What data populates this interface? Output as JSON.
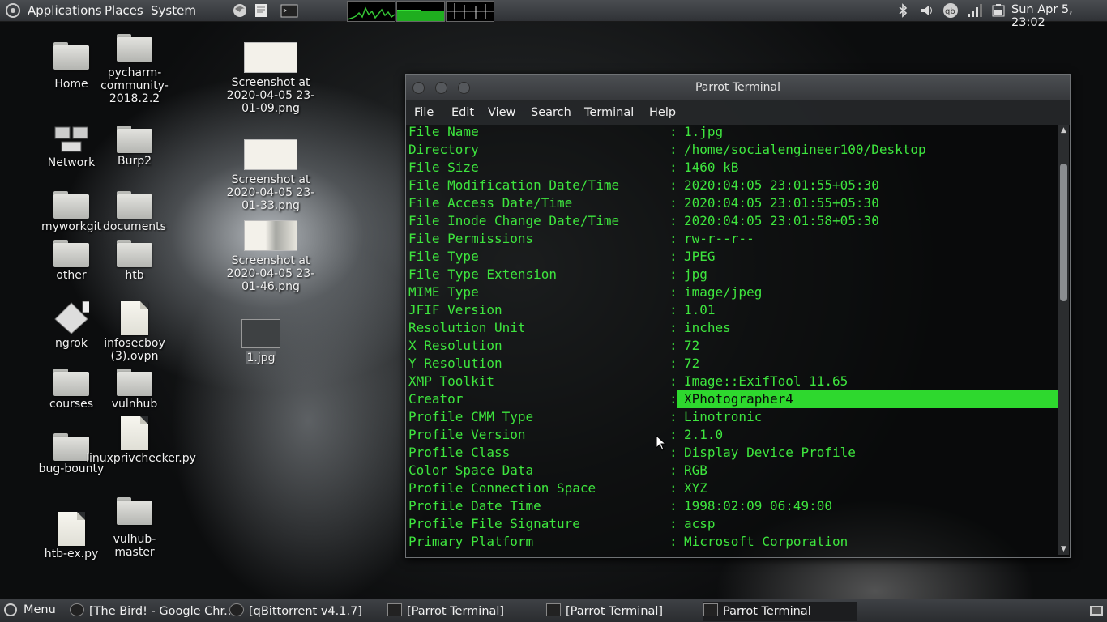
{
  "top_panel": {
    "menus": [
      "Applications",
      "Places",
      "System"
    ],
    "clock": "Sun Apr  5, 23:02",
    "icons": [
      "parrot-logo-icon",
      "firefox-icon",
      "text-editor-icon",
      "terminal-launcher-icon",
      "bluetooth-icon",
      "volume-icon",
      "qbittorrent-tray-icon",
      "network-signal-icon",
      "battery-icon"
    ]
  },
  "desktop": {
    "col1": [
      "Home",
      "Network",
      "myworkgit",
      "other",
      "ngrok",
      "courses",
      "bug-bounty",
      "htb-ex.py"
    ],
    "col2": [
      "pycharm-community-2018.2.2",
      "Burp2",
      "documents",
      "htb",
      "infosecboy (3).ovpn",
      "vulnhub",
      "linuxprivchecker.py",
      "vulhub-master"
    ],
    "col3": [
      "Screenshot at 2020-04-05 23-01-09.png",
      "Screenshot at 2020-04-05 23-01-33.png",
      "Screenshot at 2020-04-05 23-01-46.png",
      "1.jpg"
    ]
  },
  "terminal": {
    "title": "Parrot Terminal",
    "menu": [
      "File",
      "Edit",
      "View",
      "Search",
      "Terminal",
      "Help"
    ],
    "rows": [
      {
        "key": "File Name",
        "value": "1.jpg"
      },
      {
        "key": "Directory",
        "value": "/home/socialengineer100/Desktop"
      },
      {
        "key": "File Size",
        "value": "1460 kB"
      },
      {
        "key": "File Modification Date/Time",
        "value": "2020:04:05 23:01:55+05:30"
      },
      {
        "key": "File Access Date/Time",
        "value": "2020:04:05 23:01:55+05:30"
      },
      {
        "key": "File Inode Change Date/Time",
        "value": "2020:04:05 23:01:58+05:30"
      },
      {
        "key": "File Permissions",
        "value": "rw-r--r--"
      },
      {
        "key": "File Type",
        "value": "JPEG"
      },
      {
        "key": "File Type Extension",
        "value": "jpg"
      },
      {
        "key": "MIME Type",
        "value": "image/jpeg"
      },
      {
        "key": "JFIF Version",
        "value": "1.01"
      },
      {
        "key": "Resolution Unit",
        "value": "inches"
      },
      {
        "key": "X Resolution",
        "value": "72"
      },
      {
        "key": "Y Resolution",
        "value": "72"
      },
      {
        "key": "XMP Toolkit",
        "value": "Image::ExifTool 11.65"
      },
      {
        "key": "Creator",
        "value": "XPhotographer4"
      },
      {
        "key": "Profile CMM Type",
        "value": "Linotronic"
      },
      {
        "key": "Profile Version",
        "value": "2.1.0"
      },
      {
        "key": "Profile Class",
        "value": "Display Device Profile"
      },
      {
        "key": "Color Space Data",
        "value": "RGB"
      },
      {
        "key": "Profile Connection Space",
        "value": "XYZ"
      },
      {
        "key": "Profile Date Time",
        "value": "1998:02:09 06:49:00"
      },
      {
        "key": "Profile File Signature",
        "value": "acsp"
      },
      {
        "key": "Primary Platform",
        "value": "Microsoft Corporation"
      }
    ],
    "colon": ":"
  },
  "taskbar": {
    "menu": "Menu",
    "tasks": [
      "[The Bird! - Google Chr...",
      "[qBittorrent v4.1.7]",
      "[Parrot Terminal]",
      "[Parrot Terminal]",
      "Parrot Terminal"
    ]
  },
  "colors": {
    "terminal_green": "#3ee53e",
    "highlight": "#2ed82e"
  }
}
